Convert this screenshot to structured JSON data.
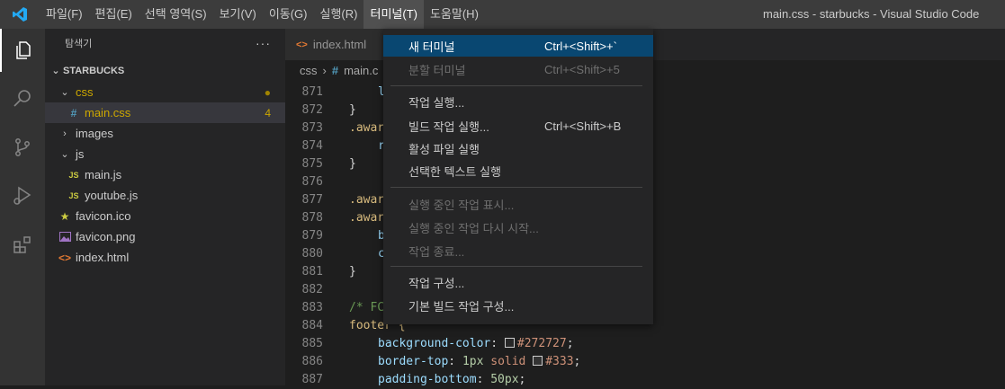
{
  "titlebar": {
    "menus": [
      "파일(F)",
      "편집(E)",
      "선택 영역(S)",
      "보기(V)",
      "이동(G)",
      "실행(R)",
      "터미널(T)",
      "도움말(H)"
    ],
    "window_title": "main.css - starbucks - Visual Studio Code"
  },
  "sidebar": {
    "title": "탐색기",
    "more": "···",
    "project": "STARBUCKS",
    "tree": {
      "css_folder": "css",
      "main_css": "main.css",
      "main_css_badge": "4",
      "images_folder": "images",
      "js_folder": "js",
      "main_js": "main.js",
      "youtube_js": "youtube.js",
      "favicon_ico": "favicon.ico",
      "favicon_png": "favicon.png",
      "index_html": "index.html"
    }
  },
  "editor": {
    "tab_label": "index.html",
    "breadcrumb": {
      "folder": "css",
      "file": "main.c"
    },
    "lines": [
      {
        "num": "871",
        "text": "l"
      },
      {
        "num": "872",
        "text": "}"
      },
      {
        "num": "873",
        "text": ".awar"
      },
      {
        "num": "874",
        "text": "r"
      },
      {
        "num": "875",
        "text": "}"
      },
      {
        "num": "876",
        "text": ""
      },
      {
        "num": "877",
        "text": ".awar"
      },
      {
        "num": "878",
        "text": ".awar"
      },
      {
        "num": "879",
        "text": "b"
      },
      {
        "num": "880",
        "text": "c"
      },
      {
        "num": "881",
        "text": "}"
      },
      {
        "num": "882",
        "text": ""
      },
      {
        "num": "883",
        "text": "/* FC"
      },
      {
        "num": "884",
        "text": "footer {"
      },
      {
        "num": "885",
        "prop": "background-color",
        "value": "#272727",
        "swatch": "#272727"
      },
      {
        "num": "886",
        "prop": "border-top",
        "value1": "1px",
        "value2": "solid",
        "value": "#333",
        "swatch": "#333333"
      },
      {
        "num": "887",
        "prop": "padding-bottom",
        "value1": "50px"
      }
    ]
  },
  "terminal_menu": {
    "new_terminal": {
      "label": "새 터미널",
      "shortcut": "Ctrl+<Shift>+`"
    },
    "split_terminal": {
      "label": "분할 터미널",
      "shortcut": "Ctrl+<Shift>+5"
    },
    "run_task": {
      "label": "작업 실행..."
    },
    "run_build_task": {
      "label": "빌드 작업 실행...",
      "shortcut": "Ctrl+<Shift>+B"
    },
    "run_active_file": {
      "label": "활성 파일 실행"
    },
    "run_selected_text": {
      "label": "선택한 텍스트 실행"
    },
    "show_running_tasks": {
      "label": "실행 중인 작업 표시..."
    },
    "restart_running_task": {
      "label": "실행 중인 작업 다시 시작..."
    },
    "terminate_task": {
      "label": "작업 종료..."
    },
    "configure_tasks": {
      "label": "작업 구성..."
    },
    "configure_default_build": {
      "label": "기본 빌드 작업 구성..."
    }
  },
  "colors": {
    "accent": "#094771",
    "css_folder": "#cca700",
    "js_icon": "#cbcb41",
    "html_icon": "#e37933",
    "css_icon": "#519aba"
  }
}
